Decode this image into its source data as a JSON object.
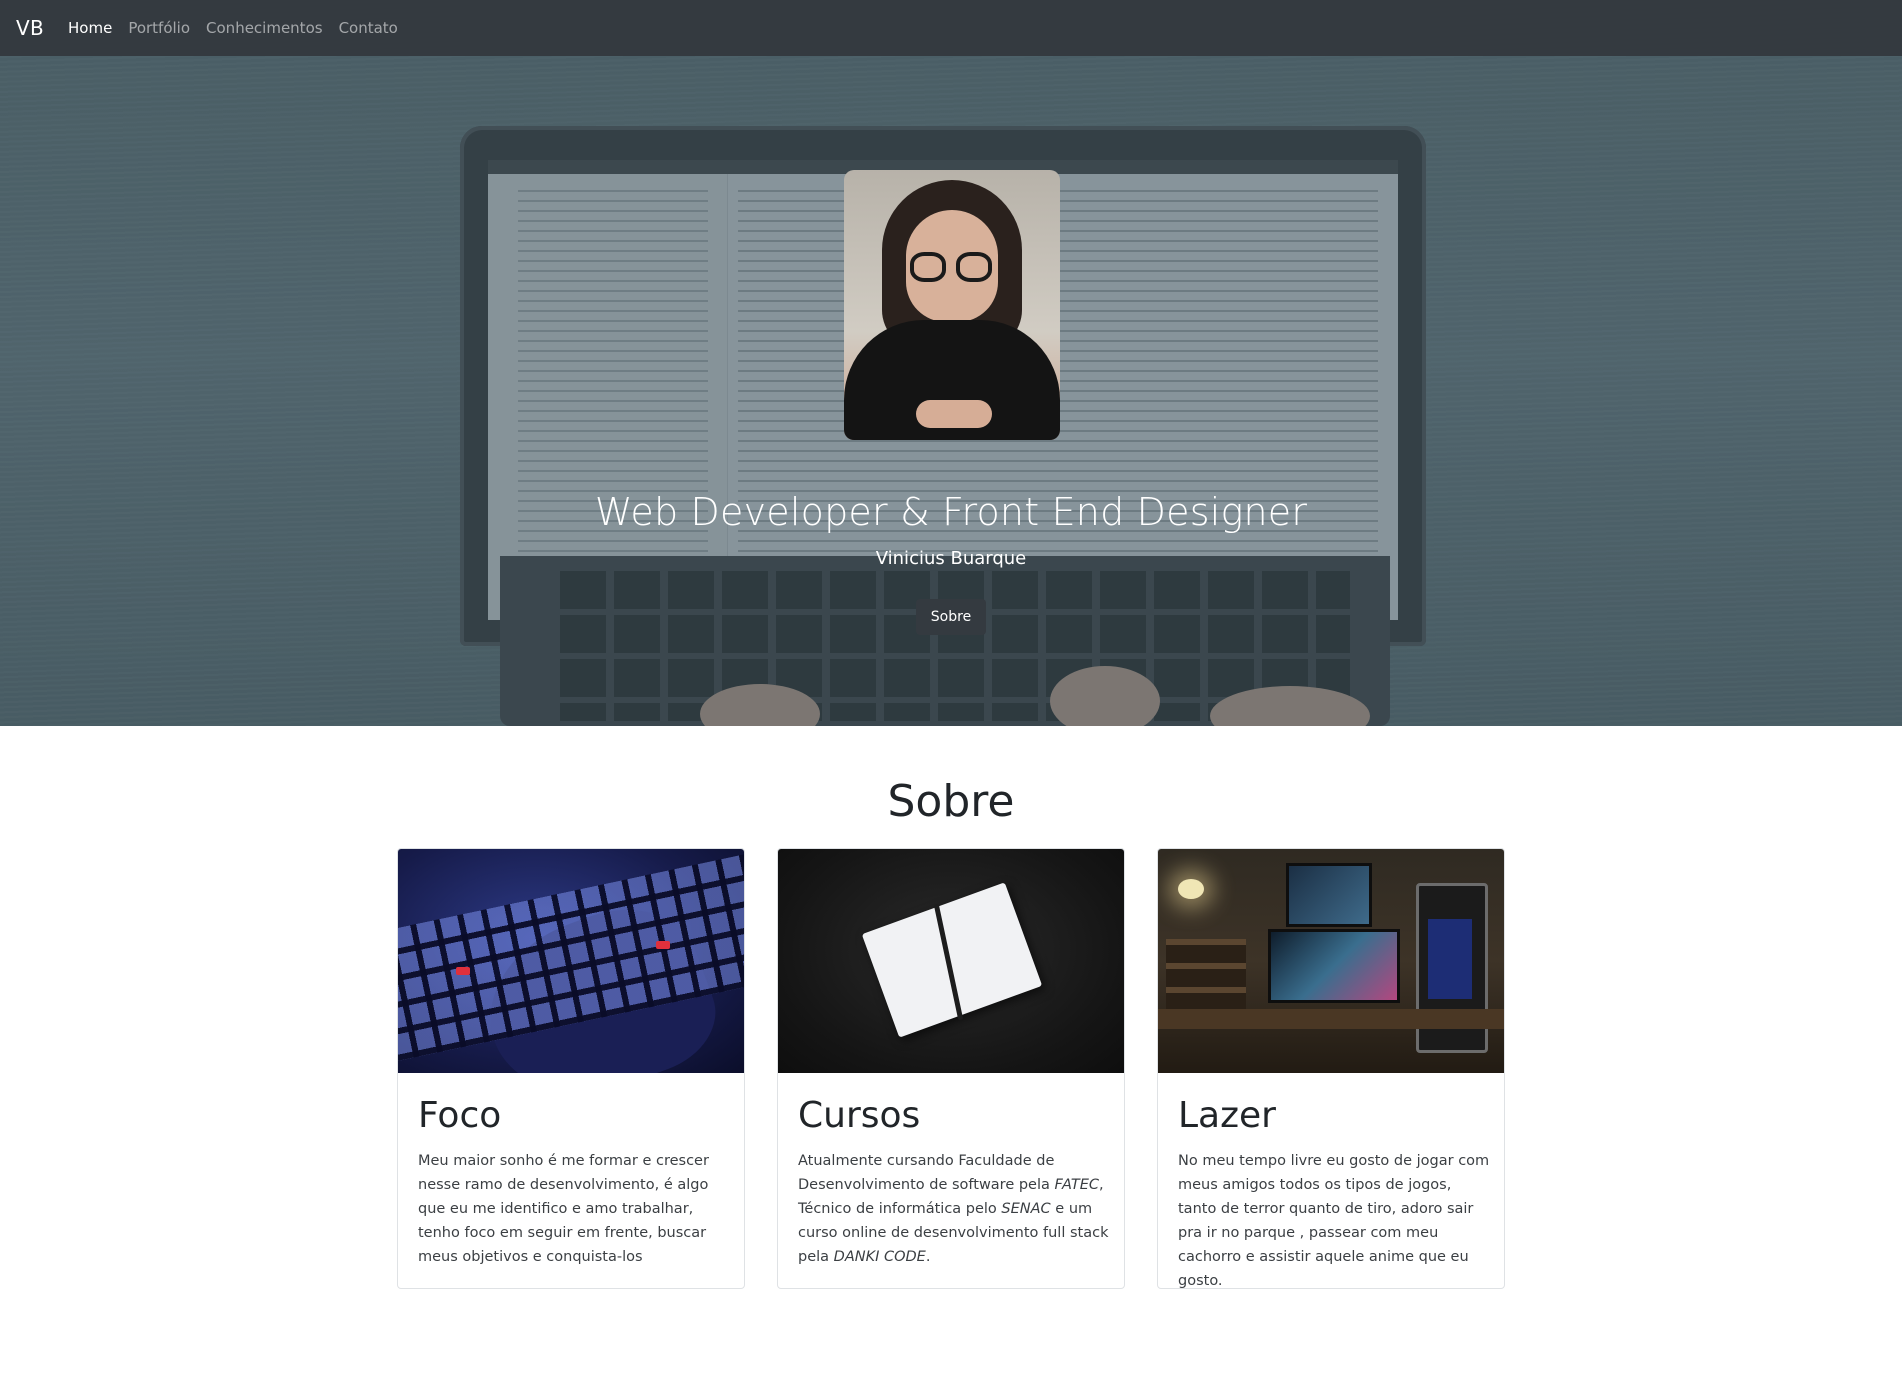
{
  "navbar": {
    "brand": "VB",
    "links": [
      {
        "label": "Home",
        "active": true
      },
      {
        "label": "Portfólio",
        "active": false
      },
      {
        "label": "Conhecimentos",
        "active": false
      },
      {
        "label": "Contato",
        "active": false
      }
    ]
  },
  "hero": {
    "title": "Web Developer & Front End Designer",
    "subtitle": "Vinicius Buarque",
    "button_label": "Sobre"
  },
  "sobre": {
    "heading": "Sobre",
    "cards": [
      {
        "title": "Foco",
        "text": "Meu maior sonho é me formar e crescer nesse ramo de desenvolvimento, é algo que eu me identifico e amo trabalhar, tenho foco em seguir em frente, buscar meus objetivos e conquista-los"
      },
      {
        "title": "Cursos",
        "text_parts": [
          "Atualmente cursando Faculdade de Desenvolvimento de software pela ",
          "FATEC",
          ", Técnico de informática pelo ",
          "SENAC",
          " e um curso online de desenvolvimento full stack pela ",
          "DANKI CODE",
          "."
        ]
      },
      {
        "title": "Lazer",
        "text": "No meu tempo livre eu gosto de jogar com meus amigos todos os tipos de jogos, tanto de terror quanto de tiro, adoro sair pra ir no parque , passear com meu cachorro e assistir aquele anime que eu gosto."
      }
    ]
  },
  "colors": {
    "navbar_bg": "#343a40",
    "nav_active": "#ffffff",
    "nav_inactive": "rgba(255,255,255,0.55)",
    "hero_button_bg": "#343a40"
  }
}
